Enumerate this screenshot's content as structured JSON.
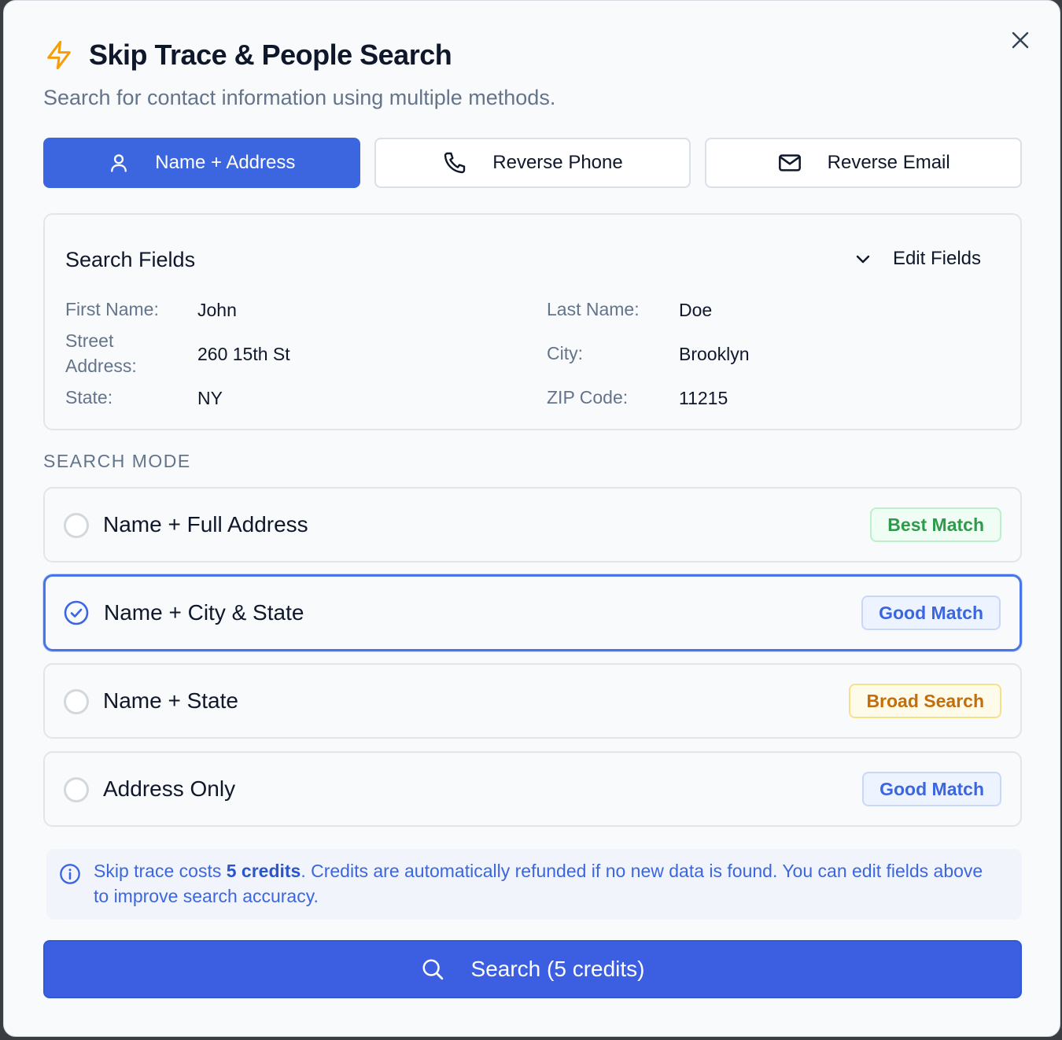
{
  "dialog": {
    "title": "Skip Trace & People Search",
    "subtitle": "Search for contact information using multiple methods."
  },
  "tabs": [
    {
      "label": "Name + Address",
      "icon": "user-icon",
      "active": true
    },
    {
      "label": "Reverse Phone",
      "icon": "phone-icon",
      "active": false
    },
    {
      "label": "Reverse Email",
      "icon": "mail-icon",
      "active": false
    }
  ],
  "search_fields": {
    "title": "Search Fields",
    "edit_label": "Edit Fields",
    "first_name_label": "First Name:",
    "first_name": "John",
    "last_name_label": "Last Name:",
    "last_name": "Doe",
    "street_label_1": "Street",
    "street_label_2": "Address:",
    "street": "260 15th St",
    "city_label": "City:",
    "city": "Brooklyn",
    "state_label": "State:",
    "state": "NY",
    "zip_label": "ZIP Code:",
    "zip": "11215"
  },
  "search_mode": {
    "label": "SEARCH MODE",
    "options": [
      {
        "label": "Name + Full Address",
        "badge": "Best Match",
        "badge_color": "#2e9a4c",
        "selected": false
      },
      {
        "label": "Name + City & State",
        "badge": "Good Match",
        "badge_color": "#3b66e0",
        "selected": true
      },
      {
        "label": "Name + State",
        "badge": "Broad Search",
        "badge_color": "#c46d0a",
        "selected": false
      },
      {
        "label": "Address Only",
        "badge": "Good Match",
        "badge_color": "#3b66e0",
        "selected": false
      }
    ]
  },
  "info": {
    "prefix": "Skip trace costs ",
    "credits": "5 credits",
    "suffix": ". Credits are automatically refunded if no new data is found. You can edit fields above to improve search accuracy."
  },
  "search_button": {
    "label": "Search (5 credits)"
  },
  "colors": {
    "primary": "#3b66e0",
    "background": "#f8fafc",
    "muted_text": "#64748b"
  }
}
